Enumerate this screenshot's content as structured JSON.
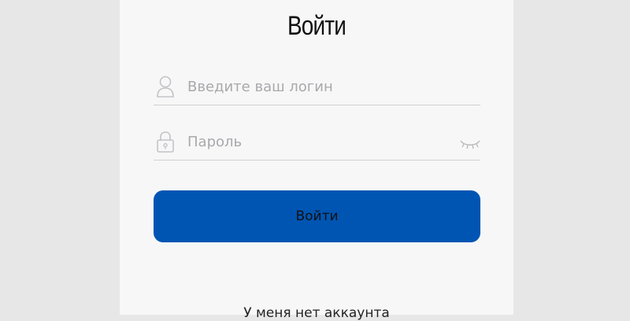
{
  "form": {
    "title": "Войти",
    "login_placeholder": "Введите ваш логин",
    "password_placeholder": "Пароль",
    "submit_label": "Войти",
    "no_account_link": "У меня нет аккаунта"
  },
  "icons": {
    "login": "user-icon",
    "password": "lock-icon",
    "toggle": "eye-closed-icon"
  },
  "colors": {
    "background": "#e7e7e7",
    "card": "#f7f7f7",
    "button": "#0055b3",
    "placeholder": "#a9a9ad",
    "icon": "#c4c4c8"
  }
}
